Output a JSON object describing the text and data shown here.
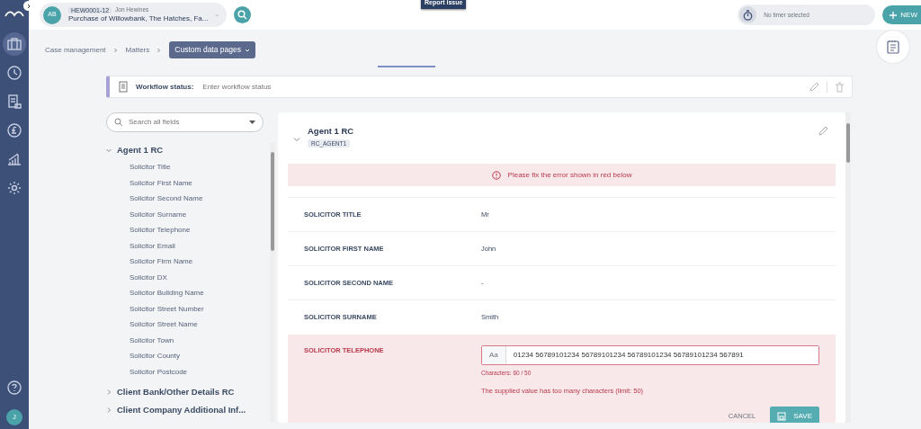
{
  "nav": [
    {
      "kind": "briefcase",
      "selected": true
    },
    {
      "kind": "clock",
      "selected": false
    },
    {
      "kind": "ledger",
      "selected": false
    },
    {
      "kind": "pound",
      "selected": false
    },
    {
      "kind": "chart",
      "selected": false
    },
    {
      "kind": "gear",
      "selected": false
    }
  ],
  "matter": {
    "avatar": "AB",
    "ref": "HEW0001-12",
    "owner": "Jon Hewines",
    "title": "Purchase of Willowbank, The Hatches, Fa..."
  },
  "report_issue": "Report issue",
  "timer": {
    "text": "No timer selected"
  },
  "new_button": "NEW",
  "user_avatar": "J",
  "breadcrumb": [
    {
      "label": "Case management",
      "current": false
    },
    {
      "label": "Matters",
      "current": false
    },
    {
      "label": "Custom data pages",
      "current": true
    }
  ],
  "workflow": {
    "label": "Workflow status:",
    "placeholder": "Enter workflow status"
  },
  "field_search": {
    "placeholder": "Search all fields"
  },
  "tree": [
    {
      "label": "Agent 1 RC",
      "expanded": true,
      "children": [
        {
          "label": "Solicitor Title"
        },
        {
          "label": "Solicitor First Name"
        },
        {
          "label": "Solicitor Second Name"
        },
        {
          "label": "Solicitor Surname"
        },
        {
          "label": "Solicitor Telephone"
        },
        {
          "label": "Solicitor Email"
        },
        {
          "label": "Solicitor Firm Name"
        },
        {
          "label": "Solicitor DX"
        },
        {
          "label": "Solicitor Building Name"
        },
        {
          "label": "Solicitor Street Number"
        },
        {
          "label": "Solicitor Street Name"
        },
        {
          "label": "Solicitor Town"
        },
        {
          "label": "Solicitor County"
        },
        {
          "label": "Solicitor Postcode"
        }
      ]
    },
    {
      "label": "Client Bank/Other Details RC",
      "expanded": false
    },
    {
      "label": "Client Company Additional Inf...",
      "expanded": false
    }
  ],
  "card": {
    "title": "Agent 1 RC",
    "code": "RC_AGENT1",
    "error_banner": "Please fix the error shown in red below",
    "rows": [
      {
        "kind": "value",
        "label": "SOLICITOR TITLE",
        "value": "Mr"
      },
      {
        "kind": "value",
        "label": "SOLICITOR FIRST NAME",
        "value": "John"
      },
      {
        "kind": "value",
        "label": "SOLICITOR SECOND NAME",
        "value": "-"
      },
      {
        "kind": "value",
        "label": "SOLICITOR SURNAME",
        "value": "Smith"
      },
      {
        "kind": "edit",
        "label": "SOLICITOR TELEPHONE",
        "prefix": "Aa",
        "value": "01234 56789101234 56789101234 56789101234 56789101234 567891",
        "counter": "Characters: 60 / 50",
        "error": "The supplied value has too many characters (limit: 50)",
        "cancel": "CANCEL",
        "save": "SAVE"
      }
    ]
  }
}
